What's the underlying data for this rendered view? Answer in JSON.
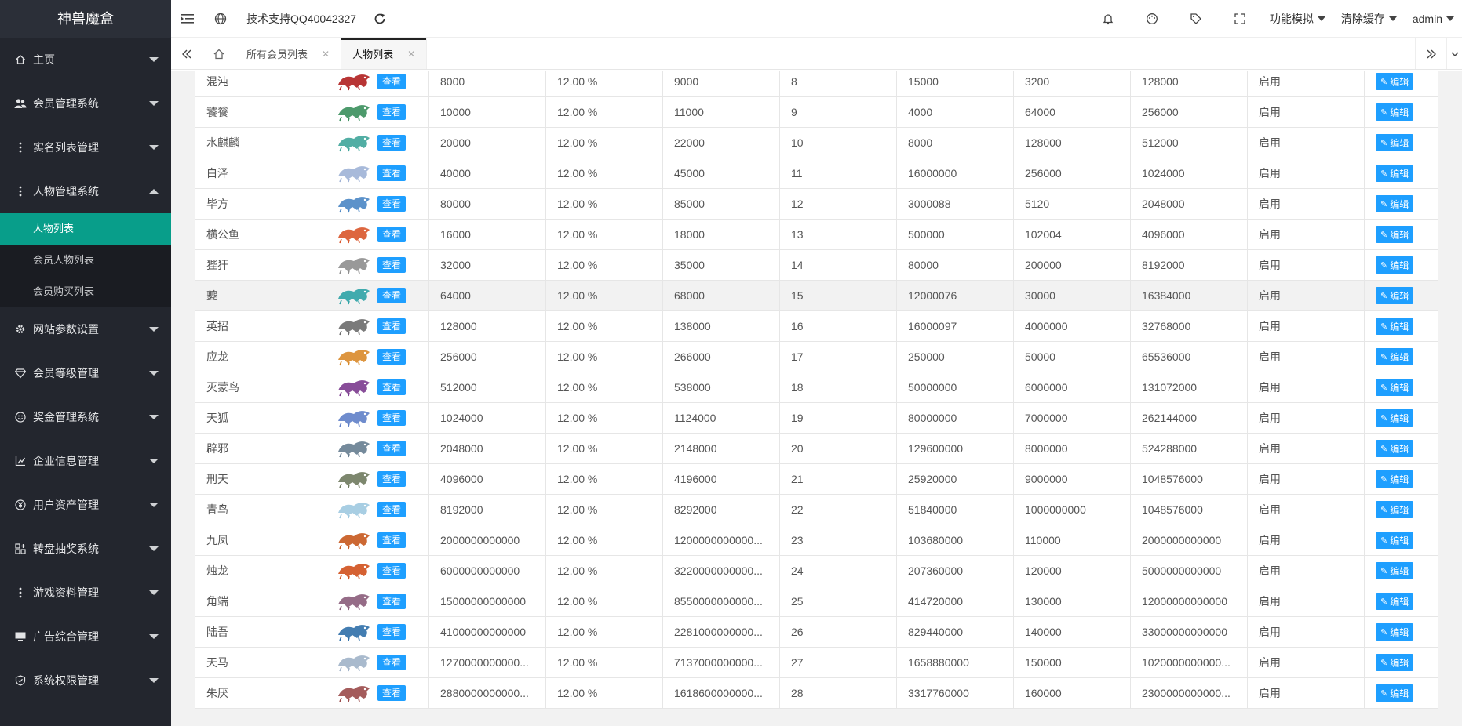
{
  "app": {
    "title": "神兽魔盒"
  },
  "sidebar": {
    "items": [
      {
        "label": "主页",
        "icon": "home-icon",
        "open": false
      },
      {
        "label": "会员管理系统",
        "icon": "users-icon",
        "open": false
      },
      {
        "label": "实名列表管理",
        "icon": "dots-icon",
        "open": false
      },
      {
        "label": "人物管理系统",
        "icon": "dots-icon",
        "open": true,
        "children": [
          {
            "label": "人物列表",
            "active": true
          },
          {
            "label": "会员人物列表",
            "active": false
          },
          {
            "label": "会员购买列表",
            "active": false
          }
        ]
      },
      {
        "label": "网站参数设置",
        "icon": "gear-icon",
        "open": false
      },
      {
        "label": "会员等级管理",
        "icon": "diamond-icon",
        "open": false
      },
      {
        "label": "奖金管理系统",
        "icon": "smile-icon",
        "open": false
      },
      {
        "label": "企业信息管理",
        "icon": "chart-icon",
        "open": false
      },
      {
        "label": "用户资产管理",
        "icon": "yen-icon",
        "open": false
      },
      {
        "label": "转盘抽奖系统",
        "icon": "grid-add-icon",
        "open": false
      },
      {
        "label": "游戏资料管理",
        "icon": "dots-icon",
        "open": false
      },
      {
        "label": "广告综合管理",
        "icon": "monitor-icon",
        "open": false
      },
      {
        "label": "系统权限管理",
        "icon": "shield-icon",
        "open": false
      }
    ]
  },
  "header": {
    "support": "技术支持QQ40042327",
    "dropdowns": {
      "simulate": "功能模拟",
      "clear_cache": "清除缓存",
      "user": "admin"
    }
  },
  "tabs": [
    {
      "label": "所有会员列表",
      "active": false
    },
    {
      "label": "人物列表",
      "active": true
    }
  ],
  "table": {
    "view_label": "查看",
    "edit_label": "编辑",
    "rows": [
      [
        "混沌",
        "8000",
        "12.00 %",
        "9000",
        "8",
        "15000",
        "3200",
        "128000",
        "启用"
      ],
      [
        "饕餮",
        "10000",
        "12.00 %",
        "11000",
        "9",
        "4000",
        "64000",
        "256000",
        "启用"
      ],
      [
        "水麒麟",
        "20000",
        "12.00 %",
        "22000",
        "10",
        "8000",
        "128000",
        "512000",
        "启用"
      ],
      [
        "白泽",
        "40000",
        "12.00 %",
        "45000",
        "11",
        "16000000",
        "256000",
        "1024000",
        "启用"
      ],
      [
        "毕方",
        "80000",
        "12.00 %",
        "85000",
        "12",
        "3000088",
        "5120",
        "2048000",
        "启用"
      ],
      [
        "横公鱼",
        "16000",
        "12.00 %",
        "18000",
        "13",
        "500000",
        "102004",
        "4096000",
        "启用"
      ],
      [
        "狴犴",
        "32000",
        "12.00 %",
        "35000",
        "14",
        "80000",
        "200000",
        "8192000",
        "启用"
      ],
      [
        "夔",
        "64000",
        "12.00 %",
        "68000",
        "15",
        "12000076",
        "30000",
        "16384000",
        "启用"
      ],
      [
        "英招",
        "128000",
        "12.00 %",
        "138000",
        "16",
        "16000097",
        "4000000",
        "32768000",
        "启用"
      ],
      [
        "应龙",
        "256000",
        "12.00 %",
        "266000",
        "17",
        "250000",
        "50000",
        "65536000",
        "启用"
      ],
      [
        "灭蒙鸟",
        "512000",
        "12.00 %",
        "538000",
        "18",
        "50000000",
        "6000000",
        "131072000",
        "启用"
      ],
      [
        "天狐",
        "1024000",
        "12.00 %",
        "1124000",
        "19",
        "80000000",
        "7000000",
        "262144000",
        "启用"
      ],
      [
        "辟邪",
        "2048000",
        "12.00 %",
        "2148000",
        "20",
        "129600000",
        "8000000",
        "524288000",
        "启用"
      ],
      [
        "刑天",
        "4096000",
        "12.00 %",
        "4196000",
        "21",
        "25920000",
        "9000000",
        "1048576000",
        "启用"
      ],
      [
        "青鸟",
        "8192000",
        "12.00 %",
        "8292000",
        "22",
        "51840000",
        "1000000000",
        "1048576000",
        "启用"
      ],
      [
        "九凤",
        "2000000000000",
        "12.00 %",
        "1200000000000...",
        "23",
        "103680000",
        "110000",
        "2000000000000",
        "启用"
      ],
      [
        "烛龙",
        "6000000000000",
        "12.00 %",
        "3220000000000...",
        "24",
        "207360000",
        "120000",
        "5000000000000",
        "启用"
      ],
      [
        "角端",
        "15000000000000",
        "12.00 %",
        "8550000000000...",
        "25",
        "414720000",
        "130000",
        "12000000000000",
        "启用"
      ],
      [
        "陆吾",
        "41000000000000",
        "12.00 %",
        "2281000000000...",
        "26",
        "829440000",
        "140000",
        "33000000000000",
        "启用"
      ],
      [
        "天马",
        "1270000000000...",
        "12.00 %",
        "7137000000000...",
        "27",
        "1658880000",
        "150000",
        "1020000000000...",
        "启用"
      ],
      [
        "朱厌",
        "2880000000000...",
        "12.00 %",
        "1618600000000...",
        "28",
        "3317760000",
        "160000",
        "2300000000000...",
        "启用"
      ]
    ],
    "beast_colors": [
      "#b01f1f",
      "#3a8f5c",
      "#3fa59a",
      "#9fb2d6",
      "#4a86c4",
      "#d9552a",
      "#8e8e8e",
      "#2ea3a6",
      "#6b6b6b",
      "#d98a2a",
      "#7b3a8e",
      "#5f7fc8",
      "#667d90",
      "#6f7a5e",
      "#9fc9e0",
      "#c7581d",
      "#d0501c",
      "#8a5c7a",
      "#2f6fa8",
      "#a0b2c8",
      "#9a4a4a"
    ]
  }
}
